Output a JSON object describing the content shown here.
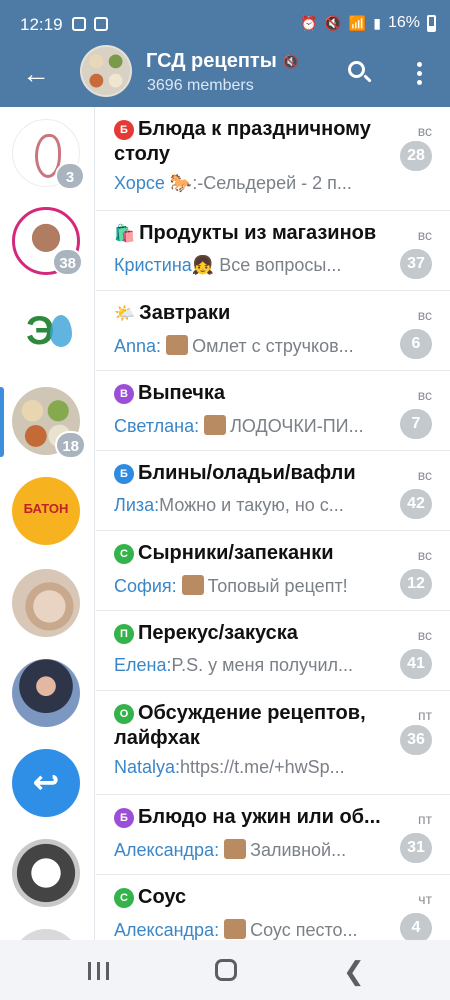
{
  "status": {
    "time": "12:19",
    "battery": "16%"
  },
  "header": {
    "title": "ГСД рецепты",
    "members": "3696 members",
    "muted_icon": "volume-mute-icon"
  },
  "rail": {
    "items": [
      {
        "name": "pregnancy-logo",
        "badge": "3"
      },
      {
        "name": "tanja-channel",
        "badge": "38"
      },
      {
        "name": "eco-news-logo",
        "badge": ""
      },
      {
        "name": "gsd-recipes",
        "badge": "18",
        "active": true
      },
      {
        "name": "baton-logo",
        "label": "БАТОН",
        "badge": ""
      },
      {
        "name": "photo-avatar",
        "badge": ""
      },
      {
        "name": "official-avatar",
        "badge": ""
      },
      {
        "name": "reply-avatar",
        "glyph": "↩",
        "badge": ""
      },
      {
        "name": "community-avatar",
        "badge": ""
      },
      {
        "name": "partial-avatar",
        "badge": ""
      }
    ]
  },
  "topics": [
    {
      "icon_letter": "Б",
      "icon_color": "#e53935",
      "title": "Блюда к праздничному столу",
      "date": "вс",
      "sender": "Хорсе 🐎",
      "text": ":-Сельдерей - 2 п...",
      "thumb": false,
      "unread": "28",
      "tall": true
    },
    {
      "emoji": "🛍️",
      "title": "Продукты из магазинов",
      "date": "вс",
      "sender": "Кристина",
      "text": " Все вопросы...",
      "sender_emoji": "👧",
      "thumb": false,
      "unread": "37"
    },
    {
      "emoji": "🌤️",
      "title": "Завтраки",
      "date": "вс",
      "sender": "Anna:",
      "text": "Омлет с стручков...",
      "thumb": true,
      "unread": "6"
    },
    {
      "icon_letter": "В",
      "icon_color": "#9c4fd6",
      "title": "Выпечка",
      "date": "вс",
      "sender": "Светлана:",
      "text": "ЛОДОЧКИ-ПИ...",
      "thumb": true,
      "unread": "7"
    },
    {
      "icon_letter": "Б",
      "icon_color": "#2d8ce0",
      "title": "Блины/оладьи/вафли",
      "date": "вс",
      "sender": "Лиза:",
      "text": "Можно и такую, но с...",
      "thumb": false,
      "unread": "42"
    },
    {
      "icon_letter": "С",
      "icon_color": "#34b34a",
      "title": "Сырники/запеканки",
      "date": "вс",
      "sender": "София:",
      "text": "Топовый рецепт!",
      "thumb": true,
      "unread": "12"
    },
    {
      "icon_letter": "П",
      "icon_color": "#34b34a",
      "title": "Перекус/закуска",
      "date": "вс",
      "sender": "Елена:",
      "text": "P.S. у меня получил...",
      "thumb": false,
      "unread": "41"
    },
    {
      "icon_letter": "О",
      "icon_color": "#34b34a",
      "title": "Обсуждение рецептов, лайфхак",
      "date": "пт",
      "sender": "Natalya:",
      "text": "https://t.me/+hwSp...",
      "thumb": false,
      "unread": "36",
      "tall": true
    },
    {
      "icon_letter": "Б",
      "icon_color": "#9c4fd6",
      "title": "Блюдо на ужин или об...",
      "date": "пт",
      "sender": "Александра:",
      "text": "Заливной...",
      "thumb": true,
      "unread": "31"
    },
    {
      "icon_letter": "С",
      "icon_color": "#34b34a",
      "title": "Соус",
      "date": "чт",
      "sender": "Александра:",
      "text": "Соус песто...",
      "thumb": true,
      "unread": "4"
    }
  ]
}
